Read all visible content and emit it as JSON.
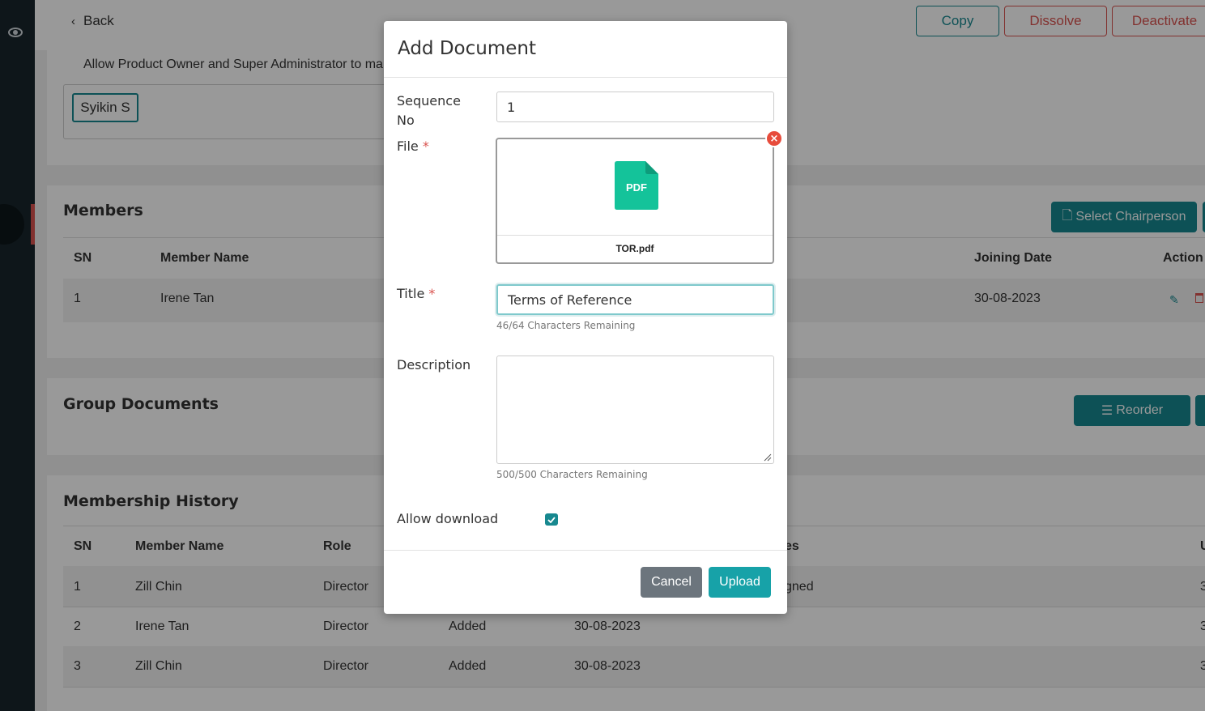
{
  "nav": {
    "back_label": "Back"
  },
  "header_buttons": {
    "copy": "Copy",
    "dissolve": "Dissolve",
    "deactivate": "Deactivate"
  },
  "settings": {
    "note": "Allow Product Owner and Super Administrator to ma",
    "chip": "Syikin S"
  },
  "members": {
    "title": "Members",
    "select_chairperson": "Select Chairperson",
    "headers": {
      "sn": "SN",
      "member_name": "Member Name",
      "joining_date": "Joining Date",
      "action": "Action"
    },
    "rows": [
      {
        "sn": "1",
        "member_name": "Irene Tan",
        "joining_date": "30-08-2023"
      }
    ]
  },
  "group_documents": {
    "title": "Group Documents",
    "reorder": "Reorder"
  },
  "membership_history": {
    "title": "Membership History",
    "headers": {
      "sn": "SN",
      "member_name": "Member Name",
      "role": "Role",
      "col_partial": "es",
      "col_edge": "U"
    },
    "rows": [
      {
        "sn": "1",
        "member_name": "Zill Chin",
        "role": "Director",
        "partial": "gned",
        "edge": "3"
      },
      {
        "sn": "2",
        "member_name": "Irene Tan",
        "role": "Director",
        "action": "Added",
        "date": "30-08-2023",
        "edge": "3"
      },
      {
        "sn": "3",
        "member_name": "Zill Chin",
        "role": "Director",
        "action": "Added",
        "date": "30-08-2023",
        "edge": "3"
      }
    ]
  },
  "modal": {
    "title": "Add Document",
    "sequence_label_1": "Sequence",
    "sequence_label_2": "No",
    "sequence_value": "1",
    "file_label": "File",
    "file_name": "TOR.pdf",
    "file_icon_text": "PDF",
    "required_mark": "*",
    "title_label": "Title",
    "title_value": "Terms of Reference",
    "title_help": "46/64 Characters Remaining",
    "description_label": "Description",
    "description_value": "",
    "description_help": "500/500 Characters Remaining",
    "allow_download_label": "Allow download",
    "allow_download_checked": true,
    "cancel": "Cancel",
    "upload": "Upload"
  },
  "colors": {
    "accent": "#17888f",
    "danger": "#d9534f",
    "pdf_green": "#14c39a"
  }
}
